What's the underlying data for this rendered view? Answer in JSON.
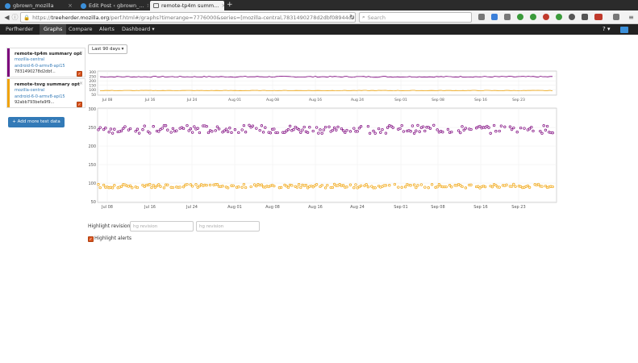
{
  "browser": {
    "tabs": [
      {
        "title": "gbrown_mozilla"
      },
      {
        "title": "Edit Post ‹ gbrown_..."
      },
      {
        "title": "remote-tp4m summ..."
      }
    ],
    "url_prefix": "https://",
    "url_host": "treeherder.mozilla.org",
    "url_rest": "/perf.html#/graphs?timerange=7776000&series=[mozilla-central,7831490278d2dbf08944c9b2e0d44d",
    "search_placeholder": "Search"
  },
  "appnav": {
    "items": [
      "Perfherder",
      "Graphs",
      "Compare",
      "Alerts",
      "Dashboard ▾"
    ],
    "help": "? ▾"
  },
  "series": [
    {
      "name": "remote-tp4m summary opt",
      "branch": "mozilla-central",
      "platform": "android-6-0-armv8-api15",
      "hash": "7831490278d2dbf...",
      "color": "#7b007b"
    },
    {
      "name": "remote-tsvg summary opt",
      "branch": "mozilla-central",
      "platform": "android-6-0-armv8-api15",
      "hash": "92abb793befa9f9...",
      "color": "#f0a30a"
    }
  ],
  "add_button": "+ Add more test data",
  "timerange": "Last 90 days ▾",
  "chart_data": {
    "type": "scatter",
    "x_ticks": [
      "Jul 08",
      "Jul 16",
      "Jul 24",
      "Aug 01",
      "Aug 08",
      "Aug 16",
      "Aug 24",
      "Sep 01",
      "Sep 08",
      "Sep 16",
      "Sep 23"
    ],
    "overview_y_ticks": [
      "300",
      "250",
      "200",
      "150",
      "100",
      "50"
    ],
    "main_y_ticks": [
      "300",
      "250",
      "200",
      "150",
      "100",
      "50"
    ],
    "ylim": [
      50,
      300
    ],
    "series": [
      {
        "color": "#7b007b",
        "approx_value": 245
      },
      {
        "color": "#f0a30a",
        "approx_value": 92
      }
    ]
  },
  "highlight": {
    "label": "Highlight revisions:",
    "placeholder1": "hg revision",
    "placeholder2": "hg revision",
    "alerts_label": "Highlight alerts"
  }
}
